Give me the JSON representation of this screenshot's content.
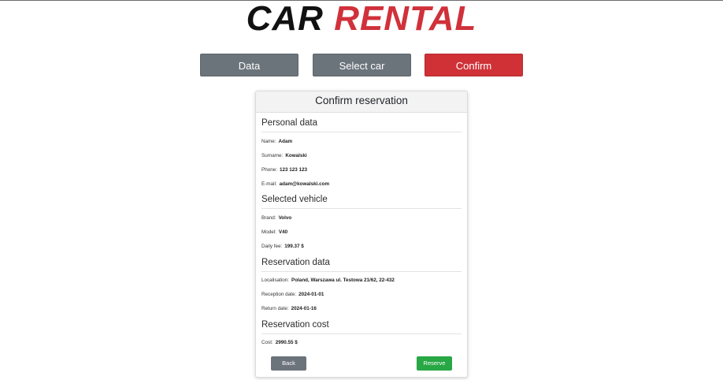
{
  "logo": {
    "word1": "CAR",
    "word2": "RENTAL"
  },
  "steps": {
    "data_label": "Data",
    "select_car_label": "Select car",
    "confirm_label": "Confirm"
  },
  "card": {
    "title": "Confirm reservation",
    "personal": {
      "heading": "Personal data",
      "name_label": "Name:",
      "name_value": "Adam",
      "surname_label": "Surname:",
      "surname_value": "Kowalski",
      "phone_label": "Phone:",
      "phone_value": "123 123 123",
      "email_label": "E-mail:",
      "email_value": "adam@kowalski.com"
    },
    "vehicle": {
      "heading": "Selected vehicle",
      "brand_label": "Brand:",
      "brand_value": "Volvo",
      "model_label": "Model:",
      "model_value": "V40",
      "fee_label": "Daily fee:",
      "fee_value": "199.37 $"
    },
    "reservation": {
      "heading": "Reservation data",
      "localisation_label": "Localisation:",
      "localisation_value": "Poland, Warszawa ul. Testowa 21/62, 22-432",
      "reception_label": "Reception date:",
      "reception_value": "2024-01-01",
      "return_label": "Return date:",
      "return_value": "2024-01-16"
    },
    "cost": {
      "heading": "Reservation cost",
      "cost_label": "Cost:",
      "cost_value": "2990.55 $"
    },
    "back_label": "Back",
    "reserve_label": "Reserve"
  },
  "colors": {
    "accent_red": "#cf3137",
    "step_gray": "#6b737b",
    "reserve_green": "#28a745"
  }
}
